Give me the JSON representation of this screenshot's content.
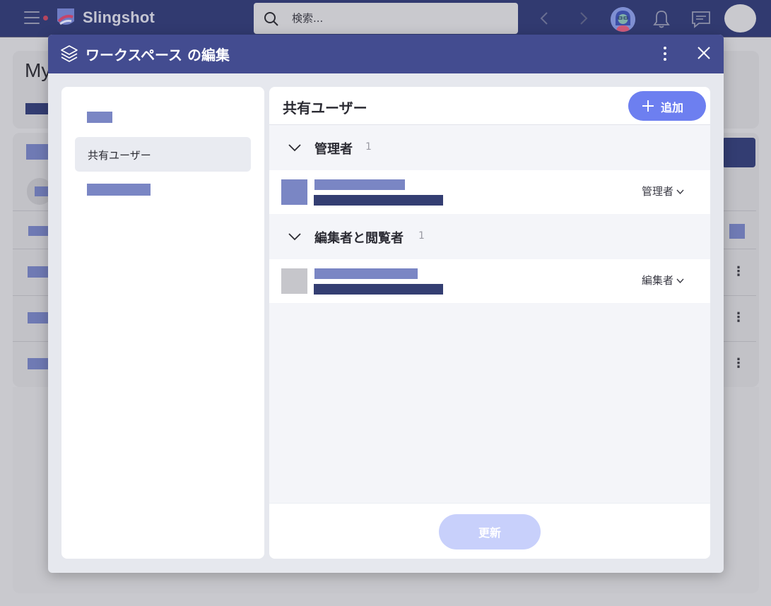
{
  "app": {
    "name": "Slingshot",
    "search": {
      "placeholder": "検索..."
    },
    "colors": {
      "topbar": "#313a70",
      "accent": "#6d7ff0",
      "modal_header": "#434c90"
    }
  },
  "background": {
    "title": "My"
  },
  "modal": {
    "title": "ワークスペース の編集",
    "icon": "layers-icon",
    "sidebar": {
      "active_item": "共有ユーザー"
    },
    "panel": {
      "title": "共有ユーザー",
      "add_button": "追加",
      "update_button": "更新",
      "groups": [
        {
          "label": "管理者",
          "count": "1",
          "users": [
            {
              "role": "管理者",
              "avatar_color": "#7a86c4"
            }
          ]
        },
        {
          "label": "編集者と閲覧者",
          "count": "1",
          "users": [
            {
              "role": "編集者",
              "avatar_color": "#c6c6cb"
            }
          ]
        }
      ]
    }
  }
}
